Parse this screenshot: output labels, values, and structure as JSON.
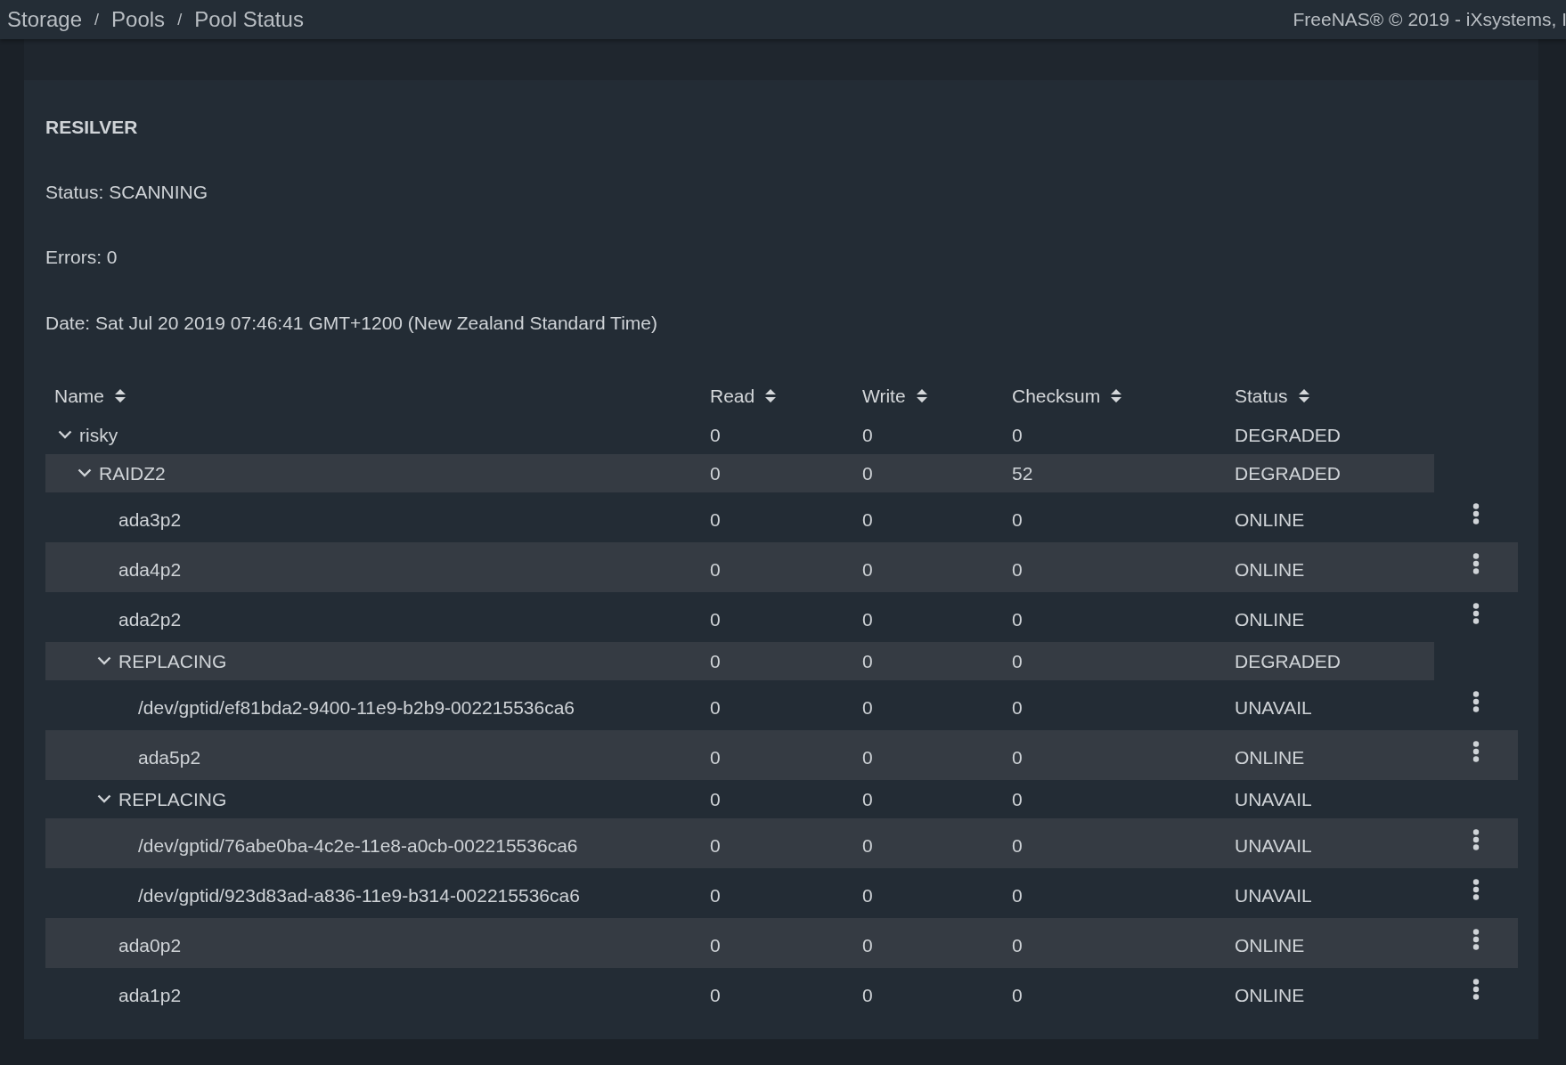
{
  "breadcrumb": {
    "separator": "/",
    "items": [
      "Storage",
      "Pools",
      "Pool Status"
    ]
  },
  "copyright": "FreeNAS® © 2019 - iXsystems, I",
  "scan": {
    "heading": "RESILVER",
    "lines": [
      "Status: SCANNING",
      "Errors: 0",
      "Date: Sat Jul 20 2019 07:46:41 GMT+1200 (New Zealand Standard Time)"
    ]
  },
  "table": {
    "columns": [
      "Name",
      "Read",
      "Write",
      "Checksum",
      "Status"
    ],
    "rows": [
      {
        "kind": "vdev",
        "name": "risky",
        "read": "0",
        "write": "0",
        "checksum": "0",
        "status": "DEGRADED",
        "expanded": true,
        "children": [
          {
            "kind": "vdev",
            "name": "RAIDZ2",
            "read": "0",
            "write": "0",
            "checksum": "52",
            "status": "DEGRADED",
            "expanded": true,
            "children": [
              {
                "kind": "disk",
                "name": "ada3p2",
                "read": "0",
                "write": "0",
                "checksum": "0",
                "status": "ONLINE"
              },
              {
                "kind": "disk",
                "name": "ada4p2",
                "read": "0",
                "write": "0",
                "checksum": "0",
                "status": "ONLINE"
              },
              {
                "kind": "disk",
                "name": "ada2p2",
                "read": "0",
                "write": "0",
                "checksum": "0",
                "status": "ONLINE"
              },
              {
                "kind": "vdev",
                "name": "REPLACING",
                "read": "0",
                "write": "0",
                "checksum": "0",
                "status": "DEGRADED",
                "expanded": true,
                "children": [
                  {
                    "kind": "disk",
                    "name": "/dev/gptid/ef81bda2-9400-11e9-b2b9-002215536ca6",
                    "read": "0",
                    "write": "0",
                    "checksum": "0",
                    "status": "UNAVAIL"
                  },
                  {
                    "kind": "disk",
                    "name": "ada5p2",
                    "read": "0",
                    "write": "0",
                    "checksum": "0",
                    "status": "ONLINE"
                  }
                ]
              },
              {
                "kind": "vdev",
                "name": "REPLACING",
                "read": "0",
                "write": "0",
                "checksum": "0",
                "status": "UNAVAIL",
                "expanded": true,
                "children": [
                  {
                    "kind": "disk",
                    "name": "/dev/gptid/76abe0ba-4c2e-11e8-a0cb-002215536ca6",
                    "read": "0",
                    "write": "0",
                    "checksum": "0",
                    "status": "UNAVAIL"
                  },
                  {
                    "kind": "disk",
                    "name": "/dev/gptid/923d83ad-a836-11e9-b314-002215536ca6",
                    "read": "0",
                    "write": "0",
                    "checksum": "0",
                    "status": "UNAVAIL"
                  }
                ]
              },
              {
                "kind": "disk",
                "name": "ada0p2",
                "read": "0",
                "write": "0",
                "checksum": "0",
                "status": "ONLINE"
              },
              {
                "kind": "disk",
                "name": "ada1p2",
                "read": "0",
                "write": "0",
                "checksum": "0",
                "status": "ONLINE"
              }
            ]
          }
        ]
      }
    ]
  }
}
